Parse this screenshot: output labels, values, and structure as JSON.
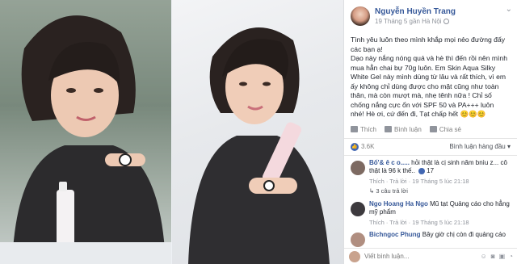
{
  "post": {
    "author": "Nguyễn Huyền Trang",
    "meta": "19 Tháng 5 gần Hà Nội",
    "paragraphs": [
      "Tình yêu luôn theo mình khắp mọi nẻo đường đấy các bạn ạ!",
      "Dạo này nắng nóng quá và hè thì đến rồi nên mình mua hẳn chai bự 70g luôn. Em Skin Aqua Silky White Gel này mình dùng từ lâu và rất thích, vì em ấy không chỉ dùng được cho mặt cũng như toàn thân, mà còn mượt mà, nhẹ tênh nữa ! Chỉ số chống nắng cực ổn với SPF 50 và PA+++ luôn nhé! Hè ơi, cứ đến đi, Tạt chấp hết 😊😊😊"
    ]
  },
  "actions": {
    "like": "Thích",
    "comment": "Bình luận",
    "share": "Chia sẻ"
  },
  "stats": {
    "likes": "3.6K",
    "sort": "Bình luận hàng đầu"
  },
  "comments": [
    {
      "name": "Bố'& ê c o.....",
      "text": "hỏi thật là cị sinh năm bnìu z... cô thật là 96 k thế..",
      "like_count": "17",
      "meta": "Thích · Trả lời · 19 Tháng 5 lúc 21:18",
      "replies": "3 câu trả lời"
    },
    {
      "name": "Ngo Hoang Ha Ngo",
      "text": "Mũ tạt Quảng cáo cho hẳng mỹ phẩm",
      "meta": "Thích · Trả lời · 19 Tháng 5 lúc 21:18"
    },
    {
      "name": "Bichngoc Phung",
      "text": "Bây giờ chị còn đi quảng cáo"
    }
  ],
  "write": {
    "placeholder": "Viết bình luận..."
  },
  "colors": {
    "link": "#365899",
    "accent": "#4267b2"
  }
}
